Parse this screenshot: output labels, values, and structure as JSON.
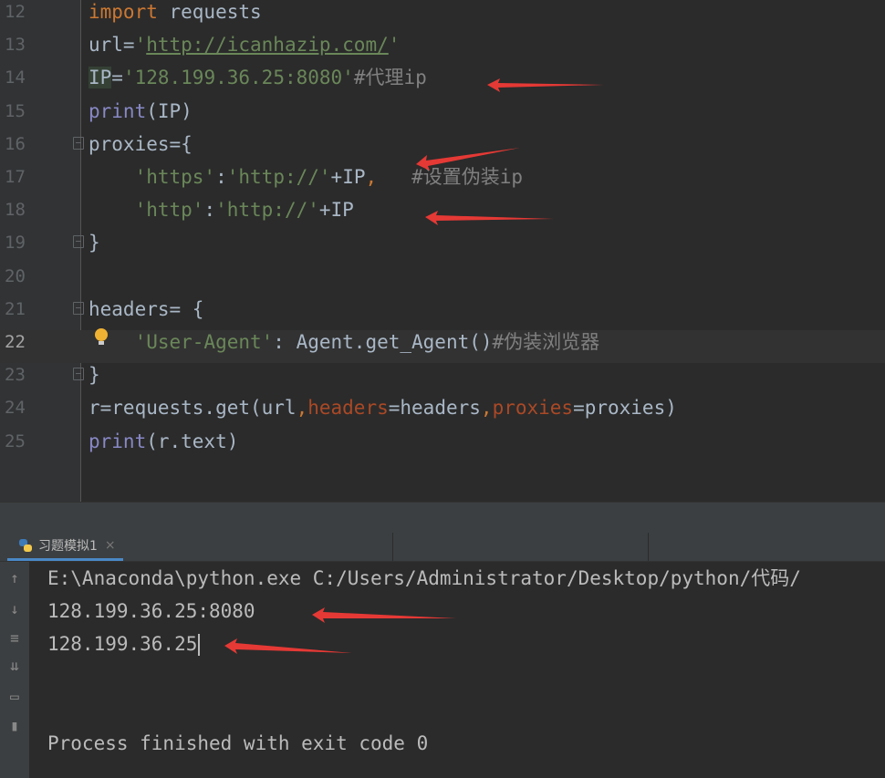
{
  "editor": {
    "lines": [
      {
        "num": "12",
        "tokens": [
          {
            "t": "import",
            "c": "kw"
          },
          {
            "t": " requests",
            "c": ""
          }
        ]
      },
      {
        "num": "13",
        "tokens": [
          {
            "t": "url=",
            "c": ""
          },
          {
            "t": "'",
            "c": "str"
          },
          {
            "t": "http://icanhazip.com/",
            "c": "url"
          },
          {
            "t": "'",
            "c": "str"
          }
        ]
      },
      {
        "num": "14",
        "tokens": [
          {
            "t": "IP",
            "c": "hl"
          },
          {
            "t": "=",
            "c": ""
          },
          {
            "t": "'128.199.36.25:8080'",
            "c": "str"
          },
          {
            "t": "#代理ip",
            "c": "cm"
          }
        ]
      },
      {
        "num": "15",
        "tokens": [
          {
            "t": "print",
            "c": "fn"
          },
          {
            "t": "(IP)",
            "c": ""
          }
        ]
      },
      {
        "num": "16",
        "tokens": [
          {
            "t": "proxies={",
            "c": ""
          }
        ]
      },
      {
        "num": "17",
        "tokens": [
          {
            "t": "    ",
            "c": ""
          },
          {
            "t": "'https'",
            "c": "str"
          },
          {
            "t": ":",
            "c": ""
          },
          {
            "t": "'http://'",
            "c": "str"
          },
          {
            "t": "+IP",
            "c": ""
          },
          {
            "t": ",",
            "c": "kw"
          },
          {
            "t": "   ",
            "c": ""
          },
          {
            "t": "#设置伪装ip",
            "c": "cm"
          }
        ]
      },
      {
        "num": "18",
        "tokens": [
          {
            "t": "    ",
            "c": ""
          },
          {
            "t": "'http'",
            "c": "str"
          },
          {
            "t": ":",
            "c": ""
          },
          {
            "t": "'http://'",
            "c": "str"
          },
          {
            "t": "+IP",
            "c": ""
          }
        ]
      },
      {
        "num": "19",
        "tokens": [
          {
            "t": "}",
            "c": ""
          }
        ]
      },
      {
        "num": "20",
        "tokens": []
      },
      {
        "num": "21",
        "tokens": [
          {
            "t": "headers= {",
            "c": ""
          }
        ]
      },
      {
        "num": "22",
        "tokens": [
          {
            "t": "    ",
            "c": ""
          },
          {
            "t": "'User-Agent'",
            "c": "str"
          },
          {
            "t": ": Agent.get_Agent()",
            "c": ""
          },
          {
            "t": "#伪装浏览器",
            "c": "cm"
          }
        ]
      },
      {
        "num": "23",
        "tokens": [
          {
            "t": "}",
            "c": ""
          }
        ]
      },
      {
        "num": "24",
        "tokens": [
          {
            "t": "r=requests.get(url",
            "c": ""
          },
          {
            "t": ",",
            "c": "kw"
          },
          {
            "t": "headers",
            "c": "param"
          },
          {
            "t": "=headers",
            "c": ""
          },
          {
            "t": ",",
            "c": "kw"
          },
          {
            "t": "proxies",
            "c": "param"
          },
          {
            "t": "=proxies)",
            "c": ""
          }
        ]
      },
      {
        "num": "25",
        "tokens": [
          {
            "t": "print",
            "c": "fn"
          },
          {
            "t": "(r.text)",
            "c": ""
          }
        ]
      }
    ]
  },
  "run_panel": {
    "tab_label": "习题模拟1",
    "tab_close": "×",
    "console_lines": [
      "E:\\Anaconda\\python.exe C:/Users/Administrator/Desktop/python/代码/",
      "128.199.36.25:8080",
      "128.199.36.25",
      "",
      "",
      "Process finished with exit code 0"
    ]
  },
  "tools": [
    "up-arrow-icon",
    "down-arrow-icon",
    "soft-wrap-icon",
    "scroll-to-end-icon",
    "print-icon",
    "trash-icon"
  ]
}
